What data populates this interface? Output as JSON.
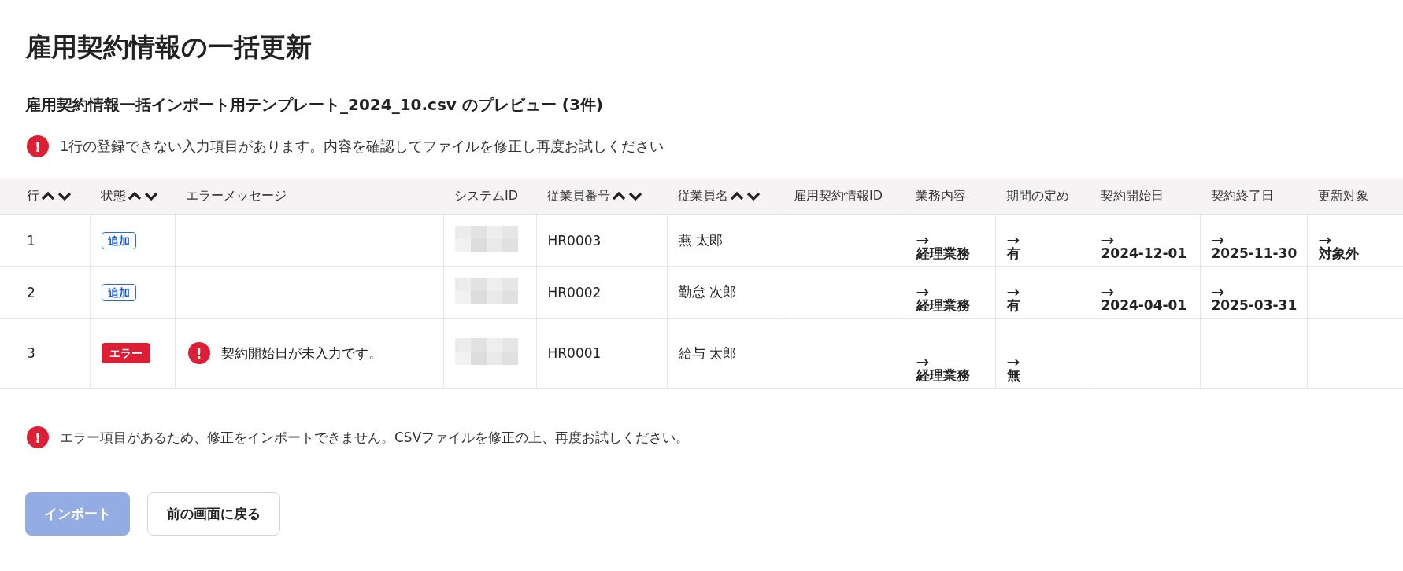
{
  "title": "雇用契約情報の一括更新",
  "preview_title": "雇用契約情報一括インポート用テンプレート_2024_10.csv のプレビュー (3件)",
  "top_alert": {
    "icon": "!",
    "text": "1行の登録できない入力項目があります。内容を確認してファイルを修正し再度お試しください"
  },
  "table": {
    "columns": [
      {
        "label": "行",
        "sortable": true
      },
      {
        "label": "状態",
        "sortable": true
      },
      {
        "label": "エラーメッセージ",
        "sortable": false
      },
      {
        "label": "システムID",
        "sortable": false
      },
      {
        "label": "従業員番号",
        "sortable": true
      },
      {
        "label": "従業員名",
        "sortable": true
      },
      {
        "label": "雇用契約情報ID",
        "sortable": false
      },
      {
        "label": "業務内容",
        "sortable": false
      },
      {
        "label": "期間の定め",
        "sortable": false
      },
      {
        "label": "契約開始日",
        "sortable": false
      },
      {
        "label": "契約終了日",
        "sortable": false
      },
      {
        "label": "更新対象",
        "sortable": false
      }
    ],
    "rows": [
      {
        "row": "1",
        "status": {
          "kind": "add",
          "label": "追加"
        },
        "system_id_redacted": true,
        "employee_no": "HR0003",
        "name": "燕 太郎",
        "job": {
          "arrow": "→",
          "value": "経理業務"
        },
        "term": {
          "arrow": "→",
          "value": "有"
        },
        "start": {
          "arrow": "→",
          "value": "2024-12-01"
        },
        "end": {
          "arrow": "→",
          "value": "2025-11-30"
        },
        "target": {
          "arrow": "→",
          "value": "対象外"
        }
      },
      {
        "row": "2",
        "status": {
          "kind": "add",
          "label": "追加"
        },
        "system_id_redacted": true,
        "employee_no": "HR0002",
        "name": "勤怠 次郎",
        "job": {
          "arrow": "→",
          "value": "経理業務"
        },
        "term": {
          "arrow": "→",
          "value": "有"
        },
        "start": {
          "arrow": "→",
          "value": "2024-04-01"
        },
        "end": {
          "arrow": "→",
          "value": "2025-03-31"
        }
      },
      {
        "row": "3",
        "status": {
          "kind": "error",
          "label": "エラー"
        },
        "error": {
          "icon": "!",
          "text": "契約開始日が未入力です。"
        },
        "system_id_redacted": true,
        "employee_no": "HR0001",
        "name": "給与 太郎",
        "job": {
          "arrow": "→",
          "value": "経理業務"
        },
        "term": {
          "arrow": "→",
          "value": "無"
        }
      }
    ]
  },
  "bottom_alert": {
    "icon": "!",
    "text": "エラー項目があるため、修正をインポートできません。CSVファイルを修正の上、再度お試しください。"
  },
  "buttons": [
    {
      "label": "インポート",
      "kind": "primary",
      "disabled": true
    },
    {
      "label": "前の画面に戻る",
      "kind": "secondary",
      "disabled": false
    }
  ]
}
